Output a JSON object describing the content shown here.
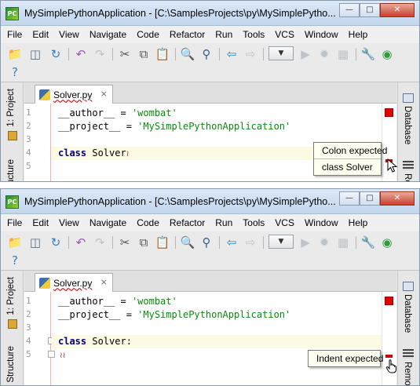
{
  "window_title": "MySimplePythonApplication - [C:\\SamplesProjects\\py\\MySimplePythonApplication]",
  "window_title_visible": "MySimplePythonApplication - [C:\\SamplesProjects\\py\\MySimplePytho...",
  "window_buttons": {
    "minimize": "—",
    "maximize": "□",
    "close": "✕"
  },
  "menu": [
    "File",
    "Edit",
    "View",
    "Navigate",
    "Code",
    "Refactor",
    "Run",
    "Tools",
    "VCS",
    "Window",
    "Help"
  ],
  "side_tabs": {
    "project": "1: Project",
    "structure": "Structure",
    "database": "Database",
    "remote": "Remote"
  },
  "editor_tab": {
    "filename": "Solver.py",
    "close": "×"
  },
  "code_top": {
    "line_numbers": [
      "1",
      "2",
      "3",
      "4",
      "5"
    ],
    "line1": {
      "name": "__author__",
      "op": " = ",
      "value": "'wombat'"
    },
    "line2": {
      "name": "__project__",
      "op": " = ",
      "value": "'MySimplePythonApplication'"
    },
    "line4": {
      "keyword": "class",
      "name": " Solver"
    }
  },
  "code_bottom": {
    "line_numbers": [
      "1",
      "2",
      "3",
      "4",
      "5"
    ],
    "line1": {
      "name": "__author__",
      "op": " = ",
      "value": "'wombat'"
    },
    "line2": {
      "name": "__project__",
      "op": " = ",
      "value": "'MySimplePythonApplication'"
    },
    "line4": {
      "keyword": "class",
      "name": " Solver:"
    }
  },
  "tooltip_top": {
    "message": "Colon expected",
    "detail": "class Solver"
  },
  "tooltip_bottom": {
    "message": "Indent expected"
  },
  "colors": {
    "error": "#e30000",
    "string": "#098a09",
    "keyword": "#000080",
    "highlight_line": "#fcfae3"
  },
  "icons": [
    "open-folder-icon",
    "save-icon",
    "sync-icon",
    "undo-icon",
    "redo-icon",
    "cut-icon",
    "copy-icon",
    "paste-icon",
    "find-icon",
    "replace-icon",
    "back-icon",
    "forward-icon",
    "run-icon",
    "debug-icon",
    "settings-icon",
    "help-icon"
  ]
}
